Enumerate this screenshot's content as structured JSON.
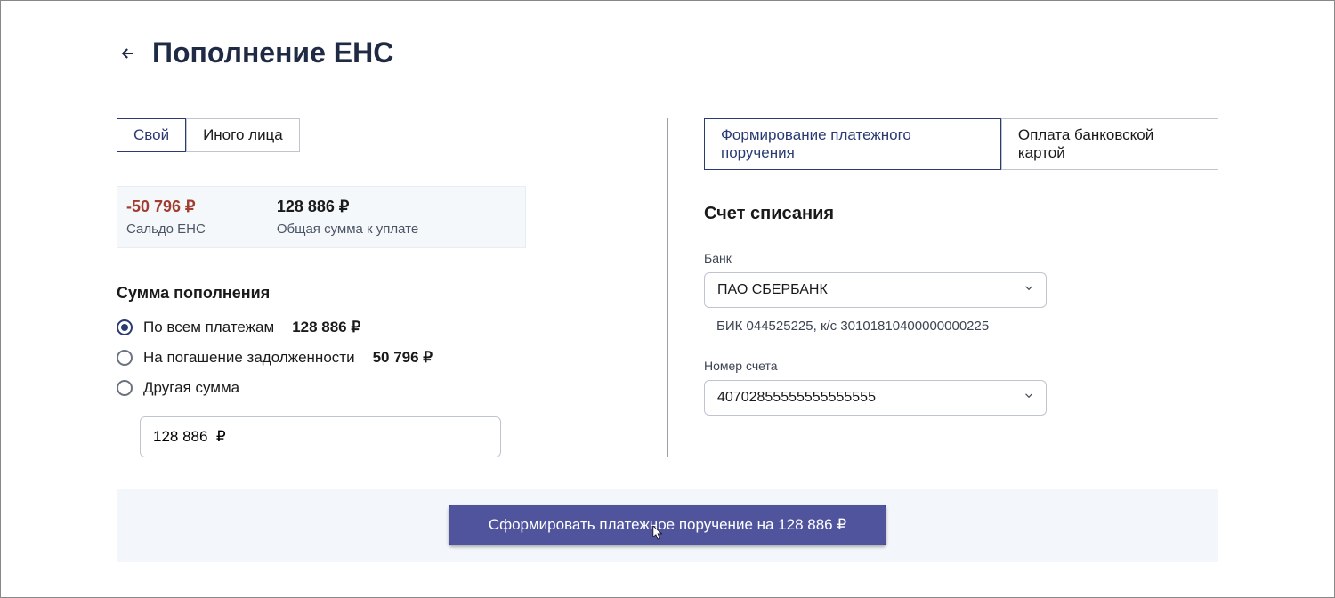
{
  "header": {
    "title": "Пополнение ЕНС"
  },
  "left": {
    "tabs": {
      "own": "Свой",
      "other": "Иного лица"
    },
    "balance": {
      "saldo_value": "-50 796 ₽",
      "saldo_label": "Сальдо ЕНС",
      "total_value": "128 886 ₽",
      "total_label": "Общая сумма к уплате"
    },
    "amount_section_title": "Сумма пополнения",
    "radios": {
      "all_label": "По всем платежам",
      "all_amount": "128 886 ₽",
      "debt_label": "На погашение задолженности",
      "debt_amount": "50 796 ₽",
      "other_label": "Другая сумма"
    },
    "amount_input_value": "128 886  ₽"
  },
  "right": {
    "tabs": {
      "form": "Формирование платежного поручения",
      "card": "Оплата банковской картой"
    },
    "account_title": "Счет списания",
    "bank_label": "Банк",
    "bank_value": "ПАО СБЕРБАНК",
    "bank_details": "БИК 044525225, к/с 30101810400000000225",
    "account_number_label": "Номер счета",
    "account_number_value": "40702855555555555555"
  },
  "footer": {
    "submit_label": "Сформировать платежное поручение на 128 886 ₽"
  }
}
